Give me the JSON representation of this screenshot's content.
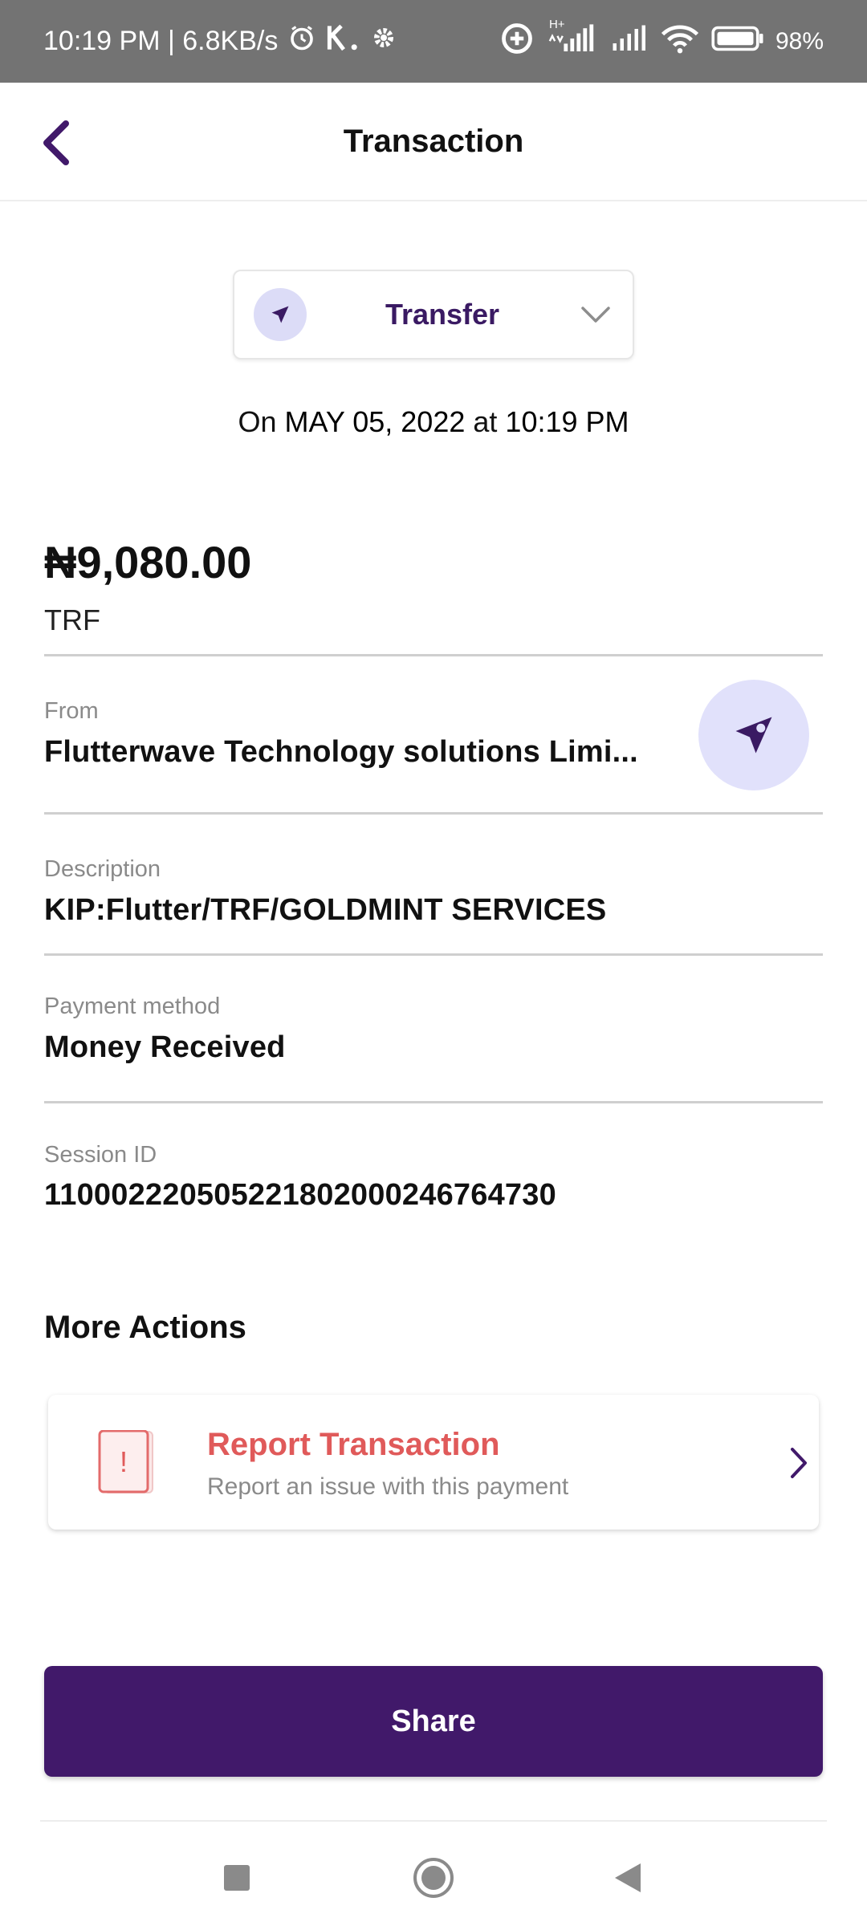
{
  "status_bar": {
    "time_speed": "10:19 PM | 6.8KB/s",
    "network": "H+",
    "battery": "98%"
  },
  "header": {
    "title": "Transaction"
  },
  "transaction_type": {
    "label": "Transfer"
  },
  "date": {
    "prefix": "On",
    "date": "MAY 05, 2022",
    "at": "at",
    "time": "10:19 PM"
  },
  "amount": {
    "value": "₦9,080.00",
    "code": "TRF"
  },
  "fields": {
    "from_label": "From",
    "from_value": "Flutterwave Technology solutions Limi...",
    "description_label": "Description",
    "description_value": "KIP:Flutter/TRF/GOLDMINT SERVICES",
    "payment_method_label": "Payment method",
    "payment_method_value": "Money Received",
    "session_id_label": "Session ID",
    "session_id_value": "110002220505221802000246764730"
  },
  "more_actions": {
    "title": "More Actions",
    "report_title": "Report Transaction",
    "report_subtitle": "Report an issue with this payment"
  },
  "share_button": "Share",
  "colors": {
    "accent": "#41196a",
    "badge_bg": "#e1e1fb",
    "report_red": "#e05a5a"
  }
}
